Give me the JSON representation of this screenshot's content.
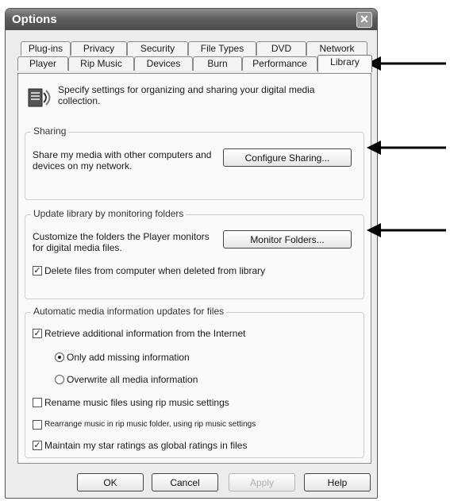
{
  "window": {
    "title": "Options"
  },
  "tabs": {
    "row1": [
      "Plug-ins",
      "Privacy",
      "Security",
      "File Types",
      "DVD",
      "Network"
    ],
    "row2": [
      "Player",
      "Rip Music",
      "Devices",
      "Burn",
      "Performance",
      "Library"
    ],
    "active": "Library"
  },
  "library": {
    "description": "Specify settings for organizing and sharing your digital media collection.",
    "icon": "library-icon",
    "sharing": {
      "label": "Sharing",
      "text": "Share my media with other computers and devices on my network.",
      "button": "Configure Sharing..."
    },
    "monitor": {
      "label": "Update library by monitoring folders",
      "text": "Customize the folders the Player monitors for digital media files.",
      "button": "Monitor Folders...",
      "delete_files": {
        "label": "Delete files from computer when deleted from library",
        "checked": true
      }
    },
    "auto": {
      "label": "Automatic media information updates for files",
      "retrieve": {
        "label": "Retrieve additional information from the Internet",
        "checked": true
      },
      "only_add": {
        "label": "Only add missing information",
        "selected": true
      },
      "overwrite": {
        "label": "Overwrite all media information",
        "selected": false
      },
      "rename": {
        "label": "Rename music files using rip music settings",
        "checked": false
      },
      "rearrange": {
        "label": "Rearrange music in rip music folder, using rip music settings",
        "checked": false
      },
      "maintain": {
        "label": "Maintain my star ratings as global ratings in files",
        "checked": true
      }
    }
  },
  "buttons": {
    "ok": "OK",
    "cancel": "Cancel",
    "apply": "Apply",
    "help": "Help"
  },
  "colors": {
    "titlebar": "#5f5f5f",
    "dialog_bg": "#ececea",
    "arrow": "#000000"
  }
}
